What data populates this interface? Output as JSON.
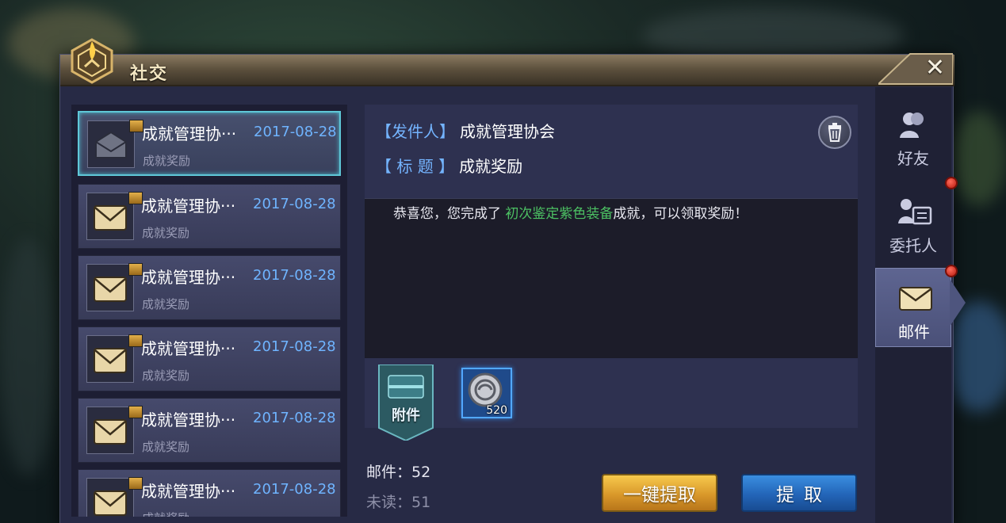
{
  "window": {
    "title": "社交"
  },
  "mail_list": [
    {
      "sender": "成就管理协···",
      "date": "2017-08-28",
      "subject": "成就奖励",
      "opened": true
    },
    {
      "sender": "成就管理协···",
      "date": "2017-08-28",
      "subject": "成就奖励",
      "opened": false
    },
    {
      "sender": "成就管理协···",
      "date": "2017-08-28",
      "subject": "成就奖励",
      "opened": false
    },
    {
      "sender": "成就管理协···",
      "date": "2017-08-28",
      "subject": "成就奖励",
      "opened": false
    },
    {
      "sender": "成就管理协···",
      "date": "2017-08-28",
      "subject": "成就奖励",
      "opened": false
    },
    {
      "sender": "成就管理协···",
      "date": "2017-08-28",
      "subject": "成就奖励",
      "opened": false
    }
  ],
  "detail": {
    "sender_label": "【发件人】",
    "sender": "成就管理协会",
    "title_label": "【 标  题 】",
    "title": "成就奖励",
    "body_prefix": "恭喜您，您完成了 ",
    "body_highlight": "初次鉴定紫色装备",
    "body_suffix": "成就，可以领取奖励！",
    "attachment_label": "附件",
    "attachment_item": {
      "icon": "coin-icon",
      "count": "520"
    }
  },
  "stats": {
    "total": "邮件：52",
    "unread": "未读：51"
  },
  "buttons": {
    "collect_all": "一键提取",
    "collect": "提取"
  },
  "side_tabs": [
    {
      "label": "好友",
      "icon": "friends-icon",
      "active": false,
      "notify": false
    },
    {
      "label": "委托人",
      "icon": "client-card-icon",
      "active": false,
      "notify": true
    },
    {
      "label": "邮件",
      "icon": "envelope-icon",
      "active": true,
      "notify": true
    }
  ],
  "colors": {
    "accent_blue": "#6fb4ff",
    "highlight_green": "#4cc163",
    "gold_button": "#d9982a",
    "blue_button": "#2365b8",
    "selected_border": "#5fc8d8"
  }
}
